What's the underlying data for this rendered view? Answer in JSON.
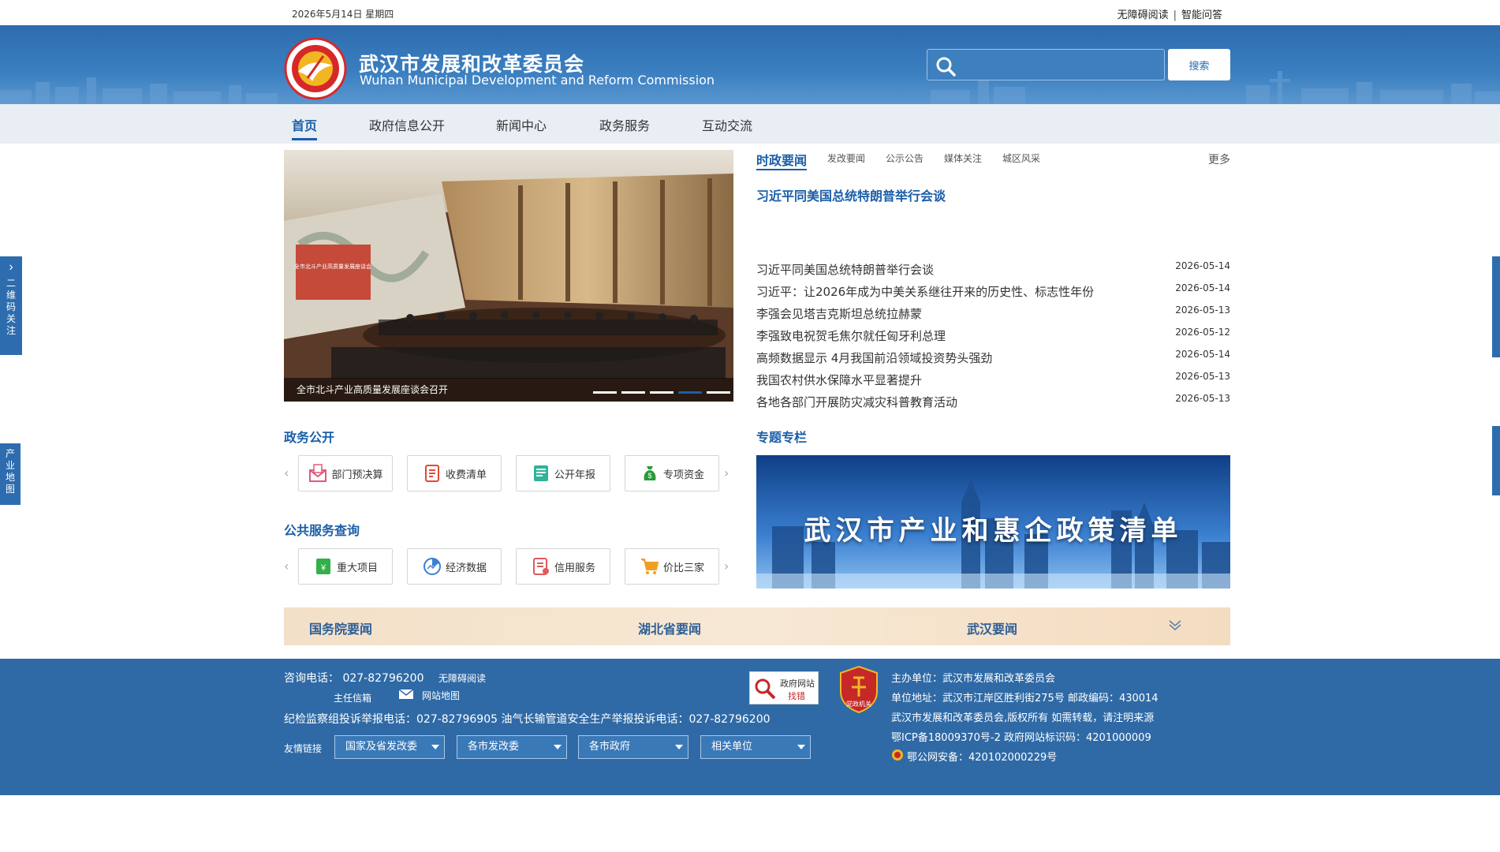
{
  "topbar": {
    "date": "2026年5月14日 星期四",
    "accessible_label": "无障碍阅读",
    "separator": "|",
    "smart_qa_label": "智能问答"
  },
  "header": {
    "title_cn": "武汉市发展和改革委员会",
    "title_en": "Wuhan Municipal Development and Reform Commission",
    "search": {
      "placeholder": "",
      "button_label": "搜索"
    }
  },
  "nav": {
    "items": [
      {
        "label": "首页",
        "active": true
      },
      {
        "label": "政府信息公开"
      },
      {
        "label": "新闻中心"
      },
      {
        "label": "政务服务"
      },
      {
        "label": "互动交流"
      }
    ]
  },
  "side_tabs": {
    "qrcode": {
      "arrow": "›",
      "label": "二维码关注"
    },
    "industry_map": {
      "label": "产业地图"
    }
  },
  "carousel": {
    "slide_text": "全市北斗产业高质量发展座谈会",
    "caption": "全市北斗产业高质量发展座谈会召开",
    "dot_count": 5,
    "active_dot": 3
  },
  "news": {
    "tabs": [
      {
        "label": "时政要闻",
        "active": true
      },
      {
        "label": "发改要闻"
      },
      {
        "label": "公示公告"
      },
      {
        "label": "媒体关注"
      },
      {
        "label": "城区风采"
      }
    ],
    "more_label": "更多",
    "headline": "习近平同美国总统特朗普举行会谈",
    "items": [
      {
        "title": "习近平同美国总统特朗普举行会谈",
        "date": "2026-05-14"
      },
      {
        "title": "习近平：让2026年成为中美关系继往开来的历史性、标志性年份",
        "date": "2026-05-14"
      },
      {
        "title": "李强会见塔吉克斯坦总统拉赫蒙",
        "date": "2026-05-13"
      },
      {
        "title": "李强致电祝贺毛焦尔就任匈牙利总理",
        "date": "2026-05-12"
      },
      {
        "title": "高频数据显示 4月我国前沿领域投资势头强劲",
        "date": "2026-05-14"
      },
      {
        "title": "我国农村供水保障水平显著提升",
        "date": "2026-05-13"
      },
      {
        "title": "各地各部门开展防灾减灾科普教育活动",
        "date": "2026-05-13"
      }
    ]
  },
  "gov_affairs": {
    "title": "政务公开",
    "prev": "‹",
    "next": "›",
    "buttons": [
      {
        "label": "部门预决算",
        "icon": "envelope-icon",
        "color": "#e05a78"
      },
      {
        "label": "收费清单",
        "icon": "list-icon",
        "color": "#e04a3a"
      },
      {
        "label": "公开年报",
        "icon": "report-icon",
        "color": "#2fb39a"
      },
      {
        "label": "专项资金",
        "icon": "money-bag-icon",
        "color": "#2a9a3a"
      }
    ]
  },
  "public_service": {
    "title": "公共服务查询",
    "prev": "‹",
    "next": "›",
    "buttons": [
      {
        "label": "重大项目",
        "icon": "project-icon",
        "color": "#33b04a"
      },
      {
        "label": "经济数据",
        "icon": "chart-circle-icon",
        "color": "#3a7fd0"
      },
      {
        "label": "信用服务",
        "icon": "credit-icon",
        "color": "#e05a5a"
      },
      {
        "label": "价比三家",
        "icon": "cart-icon",
        "color": "#f0a020"
      }
    ]
  },
  "special": {
    "title": "专题专栏",
    "banner_text": "武汉市产业和惠企政策清单"
  },
  "news_strip": {
    "items": [
      "国务院要闻",
      "湖北省要闻",
      "武汉要闻"
    ]
  },
  "footer": {
    "consult": "咨询电话：  027-82796200",
    "accessible": "无障碍阅读",
    "director_mail": "主任信箱",
    "site_map": "网站地图",
    "report_line": "纪检监察组投诉举报电话：027-82796905    油气长输管道安全生产举报投诉电话：027-82796200",
    "friend_links_label": "友情链接",
    "friend_links": [
      "国家及省发改委",
      "各市发改委",
      "各市政府",
      "相关单位"
    ],
    "gov_err": {
      "line1": "政府网站",
      "line2": "找错"
    },
    "party_badge": "党政机关",
    "host": "主办单位：武汉市发展和改革委员会",
    "address": "单位地址：武汉市江岸区胜利街275号 邮政编码：430014",
    "copyright": "武汉市发展和改革委员会,版权所有 如需转载，请注明来源",
    "icp": "鄂ICP备18009370号-2 政府网站标识码：4201000009",
    "police": "鄂公网安备：42010200022 9号",
    "police_text": "鄂公网安备：420102000229号"
  },
  "colors": {
    "brand_blue": "#2d6cae",
    "link_blue": "#1a5ea8",
    "nav_bg": "#e8eef4",
    "strip_bg": "#f3e0c8"
  }
}
